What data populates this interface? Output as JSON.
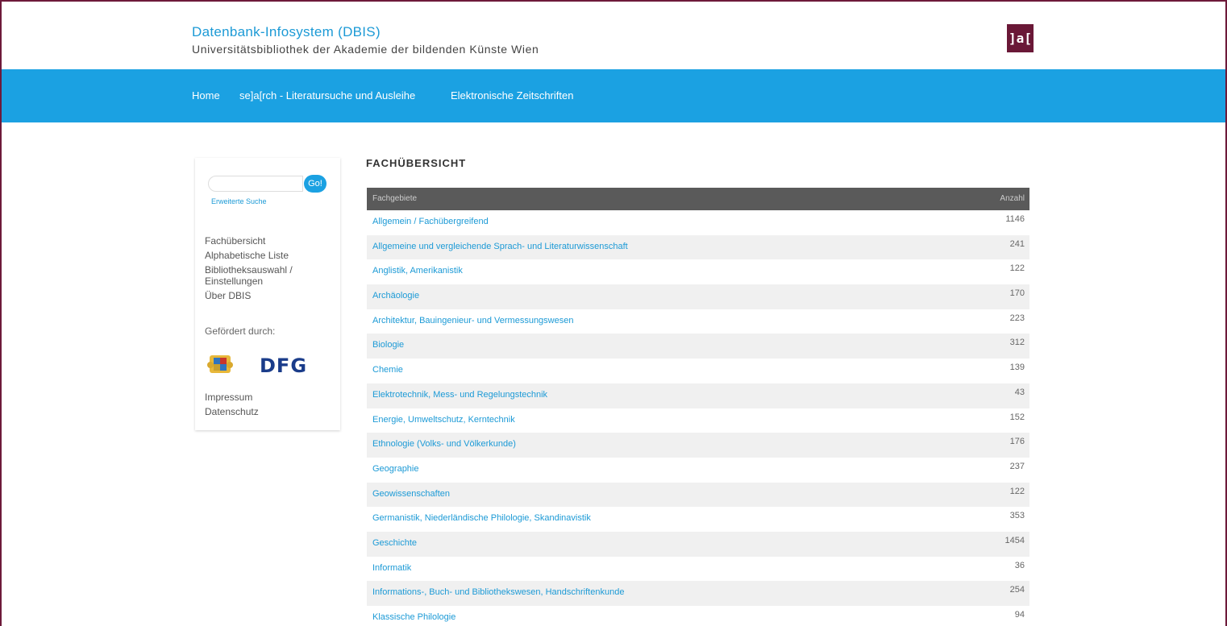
{
  "header": {
    "title": "Datenbank-Infosystem (DBIS)",
    "subtitle": "Universitätsbibliothek der Akademie der bildenden Künste Wien",
    "logo_text": "]a["
  },
  "nav": {
    "items": [
      {
        "label": "Home"
      },
      {
        "label": "se]a[rch - Literatursuche und Ausleihe"
      },
      {
        "label": "Elektronische Zeitschriften"
      }
    ]
  },
  "sidebar": {
    "search": {
      "placeholder": "",
      "go_label": "Go!",
      "advanced_label": "Erweiterte Suche"
    },
    "links": [
      "Fachübersicht",
      "Alphabetische Liste",
      "Bibliotheksauswahl / Einstellungen",
      "Über DBIS"
    ],
    "funded_label": "Gefördert durch:",
    "dfg_label": "DFG",
    "footer_links": [
      "Impressum",
      "Datenschutz"
    ]
  },
  "main": {
    "heading": "FACHÜBERSICHT",
    "table": {
      "col_subject": "Fachgebiete",
      "col_count": "Anzahl",
      "rows": [
        {
          "subject": "Allgemein / Fachübergreifend",
          "count": "1146"
        },
        {
          "subject": "Allgemeine und vergleichende Sprach- und Literaturwissenschaft",
          "count": "241"
        },
        {
          "subject": "Anglistik, Amerikanistik",
          "count": "122"
        },
        {
          "subject": "Archäologie",
          "count": "170"
        },
        {
          "subject": "Architektur, Bauingenieur- und Vermessungswesen",
          "count": "223"
        },
        {
          "subject": "Biologie",
          "count": "312"
        },
        {
          "subject": "Chemie",
          "count": "139"
        },
        {
          "subject": "Elektrotechnik, Mess- und Regelungstechnik",
          "count": "43"
        },
        {
          "subject": "Energie, Umweltschutz, Kerntechnik",
          "count": "152"
        },
        {
          "subject": "Ethnologie (Volks- und Völkerkunde)",
          "count": "176"
        },
        {
          "subject": "Geographie",
          "count": "237"
        },
        {
          "subject": "Geowissenschaften",
          "count": "122"
        },
        {
          "subject": "Germanistik, Niederländische Philologie, Skandinavistik",
          "count": "353"
        },
        {
          "subject": "Geschichte",
          "count": "1454"
        },
        {
          "subject": "Informatik",
          "count": "36"
        },
        {
          "subject": "Informations-, Buch- und Bibliothekswesen, Handschriftenkunde",
          "count": "254"
        },
        {
          "subject": "Klassische Philologie",
          "count": "94"
        }
      ]
    }
  }
}
